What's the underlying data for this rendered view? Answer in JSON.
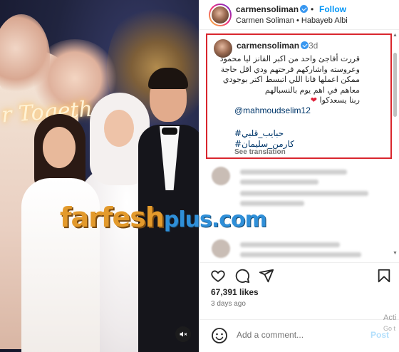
{
  "post": {
    "username": "carmensoliman",
    "follow_label": "Follow",
    "separator": "•",
    "subtitle": "Carmen Soliman • Habayeb Albi",
    "photo_neon_text": "r Togeth"
  },
  "caption": {
    "username": "carmensoliman",
    "time": "3d",
    "lines": [
      "قررت أفاجئ واحد من اكبر الفانز ليا محمود",
      "وعروسته واشاركهم فرحتهم ودي اقل حاجة",
      "ممكن اعملها فانا اللي اتبسط اكتر بوجودي",
      "معاهم في اهم يوم بالنسبالهم"
    ],
    "closing": "ربنا يسعدكوا",
    "heart": "❤",
    "mention": "@mahmoudselim12",
    "hashtags": [
      "#حبايب_قلبي",
      "#كارمن_سليمان"
    ],
    "see_translation": "See translation"
  },
  "watermark": {
    "main": "farfesh",
    "suffix": "plus.com"
  },
  "actions": {
    "like_icon": "heart-icon",
    "comment_icon": "comment-icon",
    "share_icon": "send-icon",
    "save_icon": "bookmark-icon"
  },
  "stats": {
    "likes": "67,391 likes",
    "ago": "3 days ago"
  },
  "comment_box": {
    "placeholder": "Add a comment...",
    "post_label": "Post"
  },
  "os_overlay": {
    "line1": "Acti",
    "line2": "Go t"
  },
  "colors": {
    "accent": "#0095f6",
    "highlight_border": "#d9262e",
    "link": "#00376b",
    "heart": "#e0213a"
  }
}
